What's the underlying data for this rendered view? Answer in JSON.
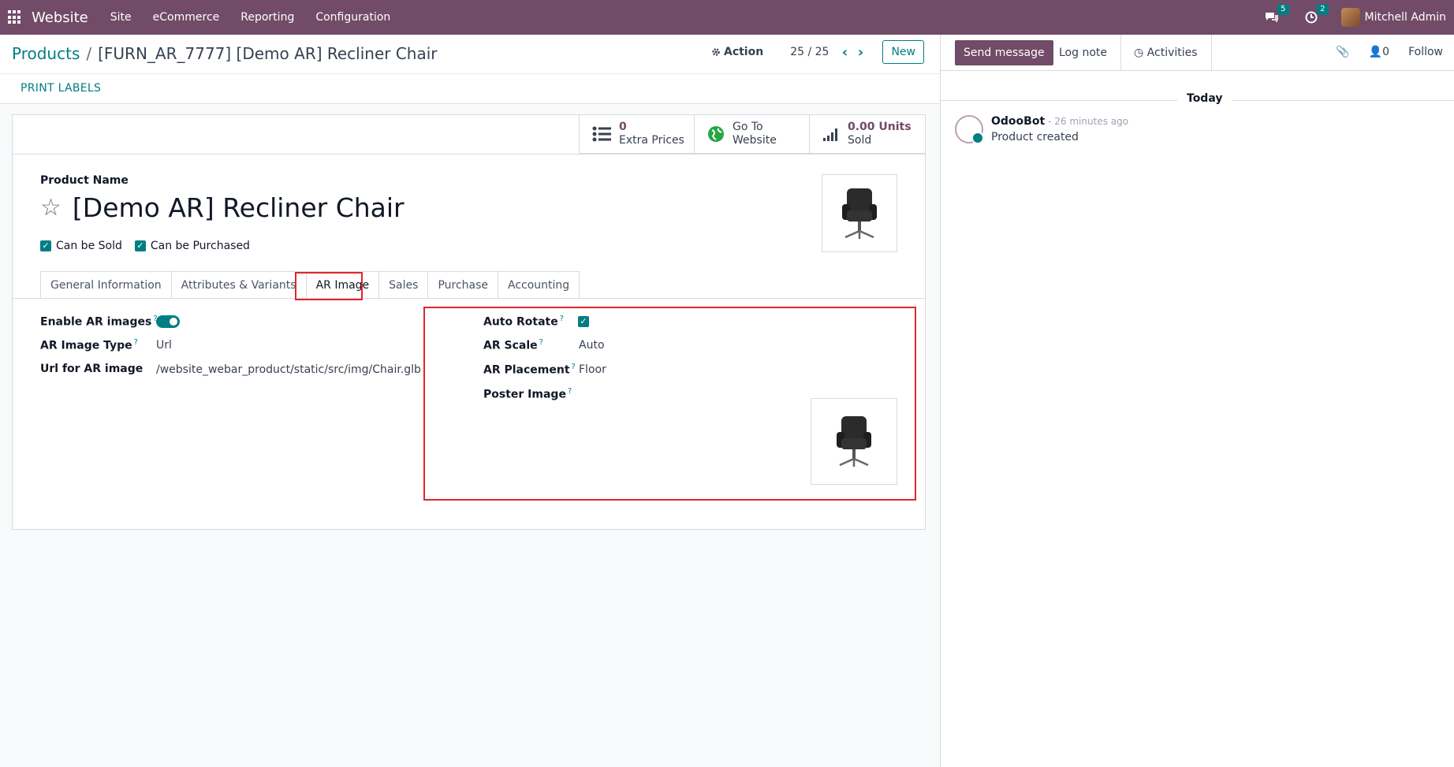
{
  "navbar": {
    "brand": "Website",
    "menu": [
      "Site",
      "eCommerce",
      "Reporting",
      "Configuration"
    ],
    "messages_count": "5",
    "activities_count": "2",
    "user_name": "Mitchell Admin"
  },
  "control_panel": {
    "breadcrumb_root": "Products",
    "breadcrumb_current": "[FURN_AR_7777] [Demo AR] Recliner Chair",
    "action_label": "Action",
    "pager": "25 / 25",
    "new_label": "New"
  },
  "statusbar": {
    "print_labels": "PRINT LABELS"
  },
  "stat_buttons": [
    {
      "value": "0",
      "label": "Extra Prices",
      "icon": "list-icon"
    },
    {
      "value": "Go To",
      "label": "Website",
      "icon": "globe-icon"
    },
    {
      "value": "0.00 Units",
      "label": "Sold",
      "icon": "signal-icon"
    }
  ],
  "form": {
    "product_name_label": "Product Name",
    "product_name": "[Demo AR] Recliner Chair",
    "can_be_sold": "Can be Sold",
    "can_be_purchased": "Can be Purchased",
    "tabs": [
      "General Information",
      "Attributes & Variants",
      "AR Image",
      "Sales",
      "Purchase",
      "Accounting"
    ],
    "active_tab": "AR Image",
    "left_fields": {
      "enable_ar_label": "Enable AR images",
      "ar_image_type_label": "AR Image Type",
      "ar_image_type_value": "Url",
      "url_label": "Url for AR image",
      "url_value": "/website_webar_product/static/src/img/Chair.glb"
    },
    "right_fields": {
      "auto_rotate_label": "Auto Rotate",
      "ar_scale_label": "AR Scale",
      "ar_scale_value": "Auto",
      "ar_placement_label": "AR Placement",
      "ar_placement_value": "Floor",
      "poster_image_label": "Poster Image"
    },
    "help_mark": "?"
  },
  "chatter": {
    "send_message": "Send message",
    "log_note": "Log note",
    "activities": "Activities",
    "followers_count": "0",
    "follow": "Follow",
    "date_separator": "Today",
    "messages": [
      {
        "author": "OdooBot",
        "time": "- 26 minutes ago",
        "body": "Product created"
      }
    ]
  },
  "colors": {
    "brand": "#714b67",
    "accent": "#017e84",
    "highlight": "#e0262b"
  }
}
